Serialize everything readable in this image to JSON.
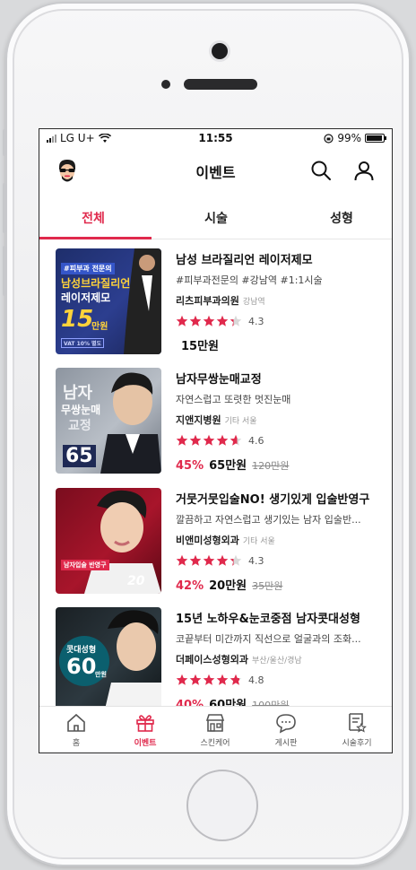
{
  "status": {
    "carrier": "LG U+",
    "time": "11:55",
    "battery": "99%"
  },
  "header": {
    "title": "이벤트",
    "icons": [
      "avatar-icon",
      "search-icon",
      "user-icon"
    ]
  },
  "tabs": [
    {
      "label": "전체",
      "active": true
    },
    {
      "label": "시술",
      "active": false
    },
    {
      "label": "성형",
      "active": false
    }
  ],
  "items": [
    {
      "name": "남성 브라질리언 레이저제모",
      "desc": "#피부과전문의 #강남역 #1:1시술",
      "clinic": "리츠피부과의원",
      "location": "강남역",
      "stars": 4.3,
      "rating": "4.3",
      "discount": "",
      "price": "15만원",
      "original": "",
      "thumb": {
        "l1": "#피부과 전문의",
        "l2": "남성브라질리언",
        "l3": "레이저제모",
        "l4": "15",
        "l5": "만원",
        "l6": "VAT 10% 별도"
      }
    },
    {
      "name": "남자무쌍눈매교정",
      "desc": "자연스럽고 또렷한 멋진눈매",
      "clinic": "지앤지병원",
      "location": "기타 서울",
      "stars": 4.6,
      "rating": "4.6",
      "discount": "45%",
      "price": "65만원",
      "original": "120만원",
      "thumb": {
        "l1": "남자",
        "l2": "무쌍눈매",
        "l3": "교정",
        "l4": "65",
        "l5": "",
        "l6": ""
      }
    },
    {
      "name": "거뭇거뭇입술NO! 생기있게 입술반영구",
      "desc": "깔끔하고 자연스럽고 생기있는 남자 입술반...",
      "clinic": "비앤미성형외과",
      "location": "기타 서울",
      "stars": 4.3,
      "rating": "4.3",
      "discount": "42%",
      "price": "20만원",
      "original": "35만원",
      "thumb": {
        "l1": "남자입술 반영구",
        "l2": "20",
        "l3": "",
        "l4": "",
        "l5": "",
        "l6": ""
      }
    },
    {
      "name": "15년 노하우&눈코중점 남자콧대성형",
      "desc": "코끝부터 미간까지 직선으로 얼굴과의 조화...",
      "clinic": "더페이스성형외과",
      "location": "부산/울산/경남",
      "stars": 4.8,
      "rating": "4.8",
      "discount": "40%",
      "price": "60만원",
      "original": "100만원",
      "thumb": {
        "l1": "콧대성형",
        "l2": "60",
        "l3": "만원",
        "l4": "",
        "l5": "",
        "l6": ""
      }
    }
  ],
  "tabbar": [
    {
      "label": "홈",
      "icon": "home-icon",
      "active": false
    },
    {
      "label": "이벤트",
      "icon": "gift-icon",
      "active": true
    },
    {
      "label": "스킨케어",
      "icon": "store-icon",
      "active": false
    },
    {
      "label": "게시판",
      "icon": "chat-icon",
      "active": false
    },
    {
      "label": "시술후기",
      "icon": "review-icon",
      "active": false
    }
  ],
  "colors": {
    "accent": "#e0294c",
    "star": "#e0294c"
  }
}
